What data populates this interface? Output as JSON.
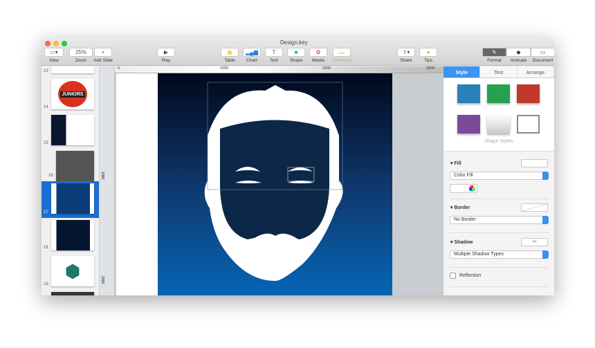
{
  "window": {
    "title": "Design.key"
  },
  "toolbar": {
    "view": "View",
    "zoom": "Zoom",
    "zoom_value": "25%",
    "add_slide": "Add Slide",
    "play": "Play",
    "table": "Table",
    "chart": "Chart",
    "text": "Text",
    "shape": "Shape",
    "media": "Media",
    "comment": "Comment",
    "share": "Share",
    "tips": "Tips",
    "format": "Format",
    "animate": "Animate",
    "document": "Document"
  },
  "ruler": {
    "h": [
      "0",
      "1000",
      "2000",
      "3000"
    ],
    "v": [
      "1000",
      "2000"
    ]
  },
  "slides": [
    {
      "num": "13"
    },
    {
      "num": "14",
      "text": "JUNIORS"
    },
    {
      "num": "15"
    },
    {
      "num": "16"
    },
    {
      "num": "17",
      "selected": true
    },
    {
      "num": "18"
    },
    {
      "num": "19"
    }
  ],
  "inspector": {
    "tabs": [
      "Style",
      "Text",
      "Arrange"
    ],
    "shape_styles_label": "Shape Styles",
    "swatch_colors": [
      "#2b80b9",
      "#27a04f",
      "#c0392b",
      "#7b4a9b",
      "#e6e6e6",
      "#ffffff"
    ],
    "fill": {
      "label": "Fill",
      "type": "Color Fill"
    },
    "border": {
      "label": "Border",
      "type": "No Border"
    },
    "shadow": {
      "label": "Shadow",
      "well": "•••",
      "type": "Multiple Shadow Types"
    },
    "reflection": "Reflection"
  }
}
